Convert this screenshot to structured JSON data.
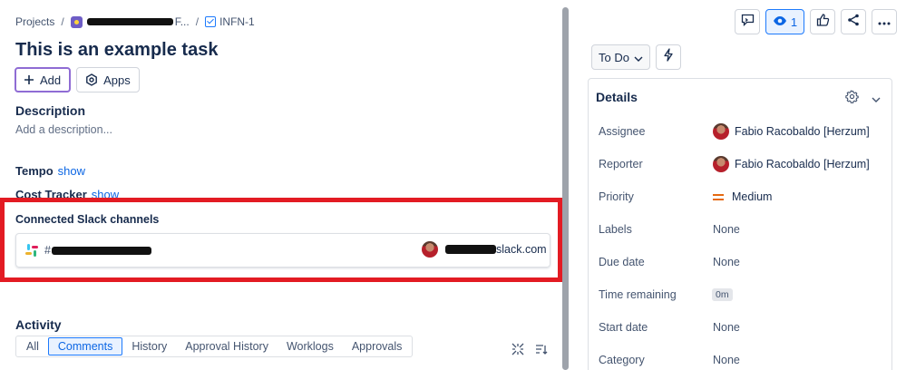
{
  "breadcrumb": {
    "projects": "Projects",
    "separator": "/",
    "project_name_suffix": "F...",
    "issue_key": "INFN-1"
  },
  "issue": {
    "title": "This is an example task",
    "add_label": "Add",
    "apps_label": "Apps"
  },
  "description": {
    "heading": "Description",
    "placeholder": "Add a description..."
  },
  "fields": {
    "tempo_label": "Tempo",
    "tempo_link": "show",
    "cost_label": "Cost Tracker",
    "cost_link": "show"
  },
  "slack": {
    "heading": "Connected Slack channels",
    "hash": "#",
    "user_suffix": "slack.com",
    "highlight_color": "#e31b23"
  },
  "activity": {
    "heading": "Activity",
    "tabs": [
      {
        "label": "All"
      },
      {
        "label": "Comments",
        "active": true
      },
      {
        "label": "History"
      },
      {
        "label": "Approval History"
      },
      {
        "label": "Worklogs"
      },
      {
        "label": "Approvals"
      }
    ]
  },
  "header_actions": {
    "watch_count": "1",
    "icons": [
      "feedback-icon",
      "watch-icon",
      "like-icon",
      "share-icon",
      "more-icon"
    ]
  },
  "status": {
    "label": "To Do"
  },
  "details": {
    "heading": "Details",
    "rows": [
      {
        "label": "Assignee",
        "value": "Fabio Racobaldo [Herzum]"
      },
      {
        "label": "Reporter",
        "value": "Fabio Racobaldo [Herzum]"
      },
      {
        "label": "Priority",
        "value": "Medium"
      },
      {
        "label": "Labels",
        "value": "None"
      },
      {
        "label": "Due date",
        "value": "None"
      },
      {
        "label": "Time remaining",
        "value": "0m"
      },
      {
        "label": "Start date",
        "value": "None"
      },
      {
        "label": "Category",
        "value": "None"
      }
    ]
  },
  "colors": {
    "accent": "#0c66e4",
    "add_button_border": "#8f6cd4",
    "priority_medium": "#e56910"
  }
}
